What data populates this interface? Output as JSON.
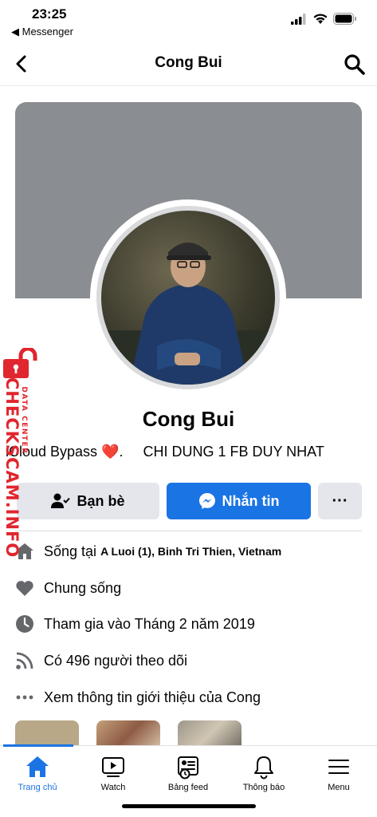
{
  "status_bar": {
    "time": "23:25",
    "back_app": "◀ Messenger"
  },
  "header": {
    "title": "Cong Bui"
  },
  "profile": {
    "name": "Cong Bui",
    "bio": "iCloud Bypass ❤️.     CHI DUNG 1 FB DUY NHAT"
  },
  "actions": {
    "friends": "Bạn bè",
    "message": "Nhắn tin",
    "more": "···"
  },
  "info": {
    "lives_prefix": "Sống tại",
    "lives_place": "A Luoi (1), Binh Tri Thien, Vietnam",
    "relationship": "Chung sống",
    "joined": "Tham gia vào Tháng 2 năm 2019",
    "followers": "Có 496 người theo dõi",
    "see_about": "Xem thông tin giới thiệu của Cong"
  },
  "watermark": {
    "brand": "CHECKSCAM.INFO",
    "sub": "DATA CENTER"
  },
  "tabs": [
    {
      "label": "Trang chủ",
      "icon": "home-icon",
      "active": true
    },
    {
      "label": "Watch",
      "icon": "watch-icon"
    },
    {
      "label": "Bảng feed",
      "icon": "feed-icon"
    },
    {
      "label": "Thông báo",
      "icon": "bell-icon"
    },
    {
      "label": "Menu",
      "icon": "menu-icon"
    }
  ],
  "colors": {
    "accent": "#1b74e4",
    "cover": "#8a8d91",
    "watermark": "#e0262e"
  }
}
